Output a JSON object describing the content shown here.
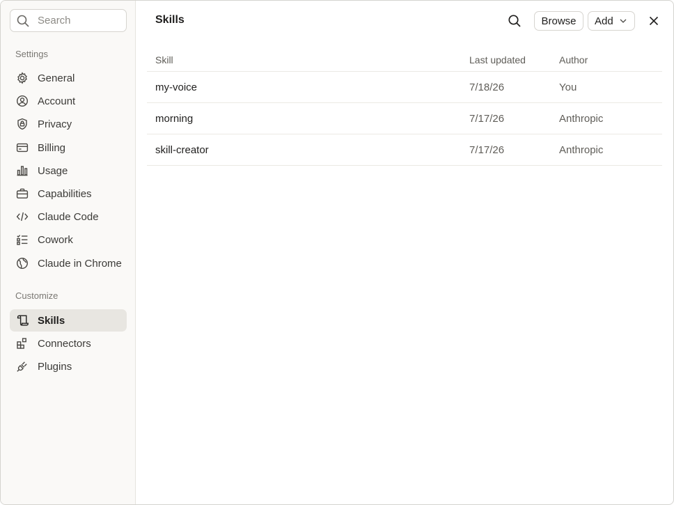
{
  "sidebar": {
    "search": {
      "placeholder": "Search",
      "value": ""
    },
    "settings_label": "Settings",
    "settings_items": [
      {
        "label": "General",
        "icon": "gear-icon"
      },
      {
        "label": "Account",
        "icon": "user-circle-icon"
      },
      {
        "label": "Privacy",
        "icon": "shield-lock-icon"
      },
      {
        "label": "Billing",
        "icon": "credit-card-icon"
      },
      {
        "label": "Usage",
        "icon": "bar-chart-icon"
      },
      {
        "label": "Capabilities",
        "icon": "briefcase-icon"
      },
      {
        "label": "Claude Code",
        "icon": "code-icon"
      },
      {
        "label": "Cowork",
        "icon": "checklist-icon"
      },
      {
        "label": "Claude in Chrome",
        "icon": "globe-icon"
      }
    ],
    "customize_label": "Customize",
    "customize_items": [
      {
        "label": "Skills",
        "icon": "scroll-icon",
        "active": true
      },
      {
        "label": "Connectors",
        "icon": "blocks-icon"
      },
      {
        "label": "Plugins",
        "icon": "plug-icon"
      }
    ]
  },
  "header": {
    "title": "Skills",
    "browse_label": "Browse",
    "add_label": "Add"
  },
  "table": {
    "columns": [
      "Skill",
      "Last updated",
      "Author"
    ],
    "rows": [
      {
        "skill": "my-voice",
        "updated": "7/18/26",
        "author": "You"
      },
      {
        "skill": "morning",
        "updated": "7/17/26",
        "author": "Anthropic"
      },
      {
        "skill": "skill-creator",
        "updated": "7/17/26",
        "author": "Anthropic"
      }
    ]
  },
  "colors": {
    "sidebar_bg": "#faf9f7",
    "active_item_bg": "#e8e6e1",
    "text": "#1f1e1d",
    "muted_text": "#5f5d58"
  }
}
